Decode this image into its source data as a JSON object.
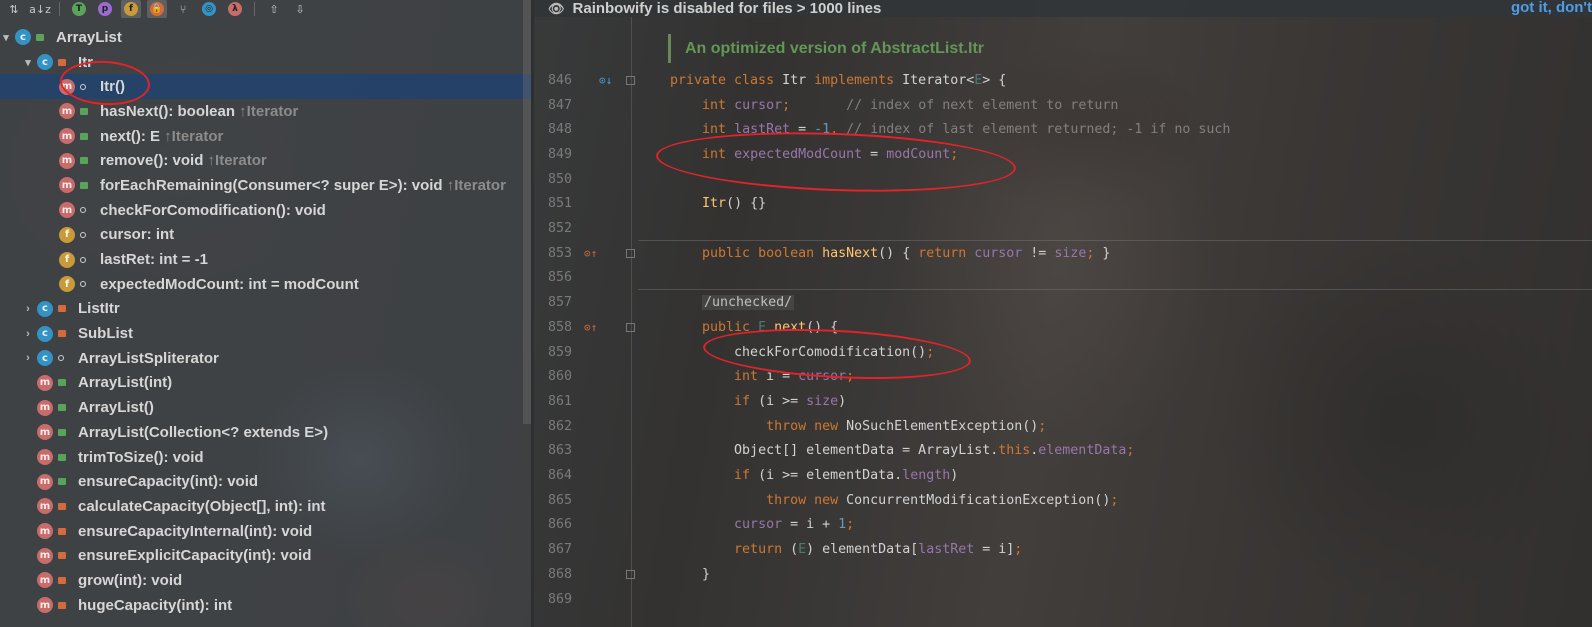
{
  "banner": {
    "message": "Rainbowify is disabled for files > 1000 lines",
    "action": "got it, don't"
  },
  "structure": {
    "toolbar": [
      {
        "icon": "sort-by-visibility-icon",
        "glyph": "⇅"
      },
      {
        "icon": "sort-alphabetically-icon",
        "glyph": "a↓z"
      },
      {
        "icon": "show-inherited-icon",
        "glyph": "T",
        "color": "#5aa35a"
      },
      {
        "icon": "show-properties-icon",
        "glyph": "p",
        "color": "#9b6bd0"
      },
      {
        "icon": "show-fields-icon",
        "glyph": "f",
        "color": "#c89a3a",
        "active": true
      },
      {
        "icon": "show-non-public-icon",
        "glyph": "🔒",
        "color": "#d36b3c",
        "active": true
      },
      {
        "icon": "show-lambdas-icon",
        "glyph": "⑂"
      },
      {
        "icon": "show-anonymous-icon",
        "glyph": "◎",
        "color": "#3592c4"
      },
      {
        "icon": "show-lambda-icon",
        "glyph": "λ",
        "color": "#c76b6b"
      },
      {
        "icon": "autoscroll-to-source-icon",
        "glyph": "⇧"
      },
      {
        "icon": "autoscroll-from-source-icon",
        "glyph": "⇩"
      }
    ],
    "items": [
      {
        "arrow": "▾",
        "indent": 0,
        "kind": "c",
        "vis": "pub",
        "label": "ArrayList",
        "suffix": ""
      },
      {
        "arrow": "▾",
        "indent": 1,
        "kind": "c",
        "vis": "priv",
        "label": "Itr",
        "suffix": ""
      },
      {
        "arrow": "",
        "indent": 2,
        "kind": "m",
        "vis": "pkg",
        "label": "Itr()",
        "suffix": "",
        "selected": true
      },
      {
        "arrow": "",
        "indent": 2,
        "kind": "m",
        "vis": "pub",
        "label": "hasNext(): boolean",
        "suffix": " ↑Iterator"
      },
      {
        "arrow": "",
        "indent": 2,
        "kind": "m",
        "vis": "pub",
        "label": "next(): E",
        "suffix": " ↑Iterator"
      },
      {
        "arrow": "",
        "indent": 2,
        "kind": "m",
        "vis": "pub",
        "label": "remove(): void",
        "suffix": " ↑Iterator"
      },
      {
        "arrow": "",
        "indent": 2,
        "kind": "m",
        "vis": "pub",
        "label": "forEachRemaining(Consumer<? super E>): void",
        "suffix": " ↑Iterator"
      },
      {
        "arrow": "",
        "indent": 2,
        "kind": "m",
        "vis": "pkg",
        "label": "checkForComodification(): void",
        "suffix": ""
      },
      {
        "arrow": "",
        "indent": 2,
        "kind": "f",
        "vis": "pkg",
        "label": "cursor: int",
        "suffix": ""
      },
      {
        "arrow": "",
        "indent": 2,
        "kind": "f",
        "vis": "pkg",
        "label": "lastRet: int = -1",
        "suffix": ""
      },
      {
        "arrow": "",
        "indent": 2,
        "kind": "f",
        "vis": "pkg",
        "label": "expectedModCount: int = modCount",
        "suffix": ""
      },
      {
        "arrow": "›",
        "indent": 1,
        "kind": "c",
        "vis": "priv",
        "label": "ListItr",
        "suffix": ""
      },
      {
        "arrow": "›",
        "indent": 1,
        "kind": "c",
        "vis": "priv",
        "label": "SubList",
        "suffix": ""
      },
      {
        "arrow": "›",
        "indent": 1,
        "kind": "c",
        "vis": "pkg",
        "label": "ArrayListSpliterator",
        "suffix": ""
      },
      {
        "arrow": "",
        "indent": 1,
        "kind": "m",
        "vis": "pub",
        "label": "ArrayList(int)",
        "suffix": ""
      },
      {
        "arrow": "",
        "indent": 1,
        "kind": "m",
        "vis": "pub",
        "label": "ArrayList()",
        "suffix": ""
      },
      {
        "arrow": "",
        "indent": 1,
        "kind": "m",
        "vis": "pub",
        "label": "ArrayList(Collection<? extends E>)",
        "suffix": ""
      },
      {
        "arrow": "",
        "indent": 1,
        "kind": "m",
        "vis": "pub",
        "label": "trimToSize(): void",
        "suffix": ""
      },
      {
        "arrow": "",
        "indent": 1,
        "kind": "m",
        "vis": "pub",
        "label": "ensureCapacity(int): void",
        "suffix": ""
      },
      {
        "arrow": "",
        "indent": 1,
        "kind": "m",
        "vis": "priv",
        "label": "calculateCapacity(Object[], int): int",
        "suffix": ""
      },
      {
        "arrow": "",
        "indent": 1,
        "kind": "m",
        "vis": "priv",
        "label": "ensureCapacityInternal(int): void",
        "suffix": ""
      },
      {
        "arrow": "",
        "indent": 1,
        "kind": "m",
        "vis": "priv",
        "label": "ensureExplicitCapacity(int): void",
        "suffix": ""
      },
      {
        "arrow": "",
        "indent": 1,
        "kind": "m",
        "vis": "priv",
        "label": "grow(int): void",
        "suffix": ""
      },
      {
        "arrow": "",
        "indent": 1,
        "kind": "m",
        "vis": "priv",
        "label": "hugeCapacity(int): int",
        "suffix": ""
      }
    ]
  },
  "editor": {
    "doc_comment": "An optimized version of AbstractList.Itr",
    "lines": [
      {
        "num": "846",
        "gutter": "implements-icon",
        "fold": true,
        "tokens": [
          [
            "kw",
            "private class "
          ],
          [
            "",
            "Itr "
          ],
          [
            "kw",
            "implements "
          ],
          [
            "",
            "Iterator<"
          ],
          [
            "gn",
            "E"
          ],
          [
            "",
            "> {"
          ]
        ]
      },
      {
        "num": "847",
        "tokens": [
          [
            "",
            "    "
          ],
          [
            "kw",
            "int "
          ],
          [
            "fd",
            "cursor"
          ],
          [
            "kw",
            ";       "
          ],
          [
            "cm",
            "// index of next element to return"
          ]
        ]
      },
      {
        "num": "848",
        "tokens": [
          [
            "",
            "    "
          ],
          [
            "kw",
            "int "
          ],
          [
            "fd",
            "lastRet"
          ],
          [
            "",
            " = "
          ],
          [
            "nm",
            "-1"
          ],
          [
            "kw",
            ", "
          ],
          [
            "cm",
            "// index of last element returned; -1 if no such"
          ]
        ]
      },
      {
        "num": "849",
        "tokens": [
          [
            "",
            "    "
          ],
          [
            "kw",
            "int "
          ],
          [
            "fd",
            "expectedModCount"
          ],
          [
            "",
            " = "
          ],
          [
            "fd",
            "modCount"
          ],
          [
            "kw",
            ";"
          ]
        ]
      },
      {
        "num": "850",
        "tokens": []
      },
      {
        "num": "851",
        "tokens": [
          [
            "",
            "    "
          ],
          [
            "fn",
            "Itr"
          ],
          [
            "",
            "() {}"
          ]
        ]
      },
      {
        "num": "852",
        "tokens": [],
        "separator_after": true
      },
      {
        "num": "853",
        "gutter": "implementing-icon",
        "fold": true,
        "tokens": [
          [
            "",
            "    "
          ],
          [
            "kw",
            "public boolean "
          ],
          [
            "fn",
            "hasNext"
          ],
          [
            "",
            "() { "
          ],
          [
            "kw",
            "return "
          ],
          [
            "fd",
            "cursor"
          ],
          [
            "",
            " != "
          ],
          [
            "fd",
            "size"
          ],
          [
            "kw",
            "; "
          ],
          [
            "",
            "}"
          ]
        ]
      },
      {
        "num": "856",
        "tokens": [],
        "separator_after": true
      },
      {
        "num": "857",
        "tokens": [
          [
            "",
            "    "
          ],
          [
            "tag",
            "/unchecked/"
          ]
        ]
      },
      {
        "num": "858",
        "gutter": "implementing-icon",
        "fold": true,
        "tokens": [
          [
            "",
            "    "
          ],
          [
            "kw",
            "public "
          ],
          [
            "gn",
            "E "
          ],
          [
            "fn",
            "next"
          ],
          [
            "",
            "() {"
          ]
        ]
      },
      {
        "num": "859",
        "tokens": [
          [
            "",
            "        "
          ],
          [
            "",
            "checkForComodification()"
          ],
          [
            "kw",
            ";"
          ]
        ]
      },
      {
        "num": "860",
        "tokens": [
          [
            "",
            "        "
          ],
          [
            "kw",
            "int "
          ],
          [
            "",
            "i = "
          ],
          [
            "fd",
            "cursor"
          ],
          [
            "kw",
            ";"
          ]
        ]
      },
      {
        "num": "861",
        "tokens": [
          [
            "",
            "        "
          ],
          [
            "kw",
            "if "
          ],
          [
            "",
            "(i >= "
          ],
          [
            "fd",
            "size"
          ],
          [
            "",
            ")"
          ]
        ]
      },
      {
        "num": "862",
        "tokens": [
          [
            "",
            "            "
          ],
          [
            "kw",
            "throw new "
          ],
          [
            "",
            "NoSuchElementException()"
          ],
          [
            "kw",
            ";"
          ]
        ]
      },
      {
        "num": "863",
        "tokens": [
          [
            "",
            "        "
          ],
          [
            "",
            "Object[] elementData = ArrayList."
          ],
          [
            "kw",
            "this"
          ],
          [
            "",
            "."
          ],
          [
            "fd",
            "elementData"
          ],
          [
            "kw",
            ";"
          ]
        ]
      },
      {
        "num": "864",
        "tokens": [
          [
            "",
            "        "
          ],
          [
            "kw",
            "if "
          ],
          [
            "",
            "(i >= elementData."
          ],
          [
            "fd",
            "length"
          ],
          [
            "",
            ")"
          ]
        ]
      },
      {
        "num": "865",
        "tokens": [
          [
            "",
            "            "
          ],
          [
            "kw",
            "throw new "
          ],
          [
            "",
            "ConcurrentModificationException()"
          ],
          [
            "kw",
            ";"
          ]
        ]
      },
      {
        "num": "866",
        "tokens": [
          [
            "",
            "        "
          ],
          [
            "fd",
            "cursor"
          ],
          [
            "",
            " = i + "
          ],
          [
            "nm",
            "1"
          ],
          [
            "kw",
            ";"
          ]
        ]
      },
      {
        "num": "867",
        "tokens": [
          [
            "",
            "        "
          ],
          [
            "kw",
            "return "
          ],
          [
            "",
            "("
          ],
          [
            "gn",
            "E"
          ],
          [
            "",
            ") elementData["
          ],
          [
            "fd",
            "lastRet"
          ],
          [
            "",
            " = i]"
          ],
          [
            "kw",
            ";"
          ]
        ]
      },
      {
        "num": "868",
        "fold": true,
        "tokens": [
          [
            "",
            "    "
          ],
          [
            "",
            "}"
          ]
        ]
      },
      {
        "num": "869",
        "tokens": []
      }
    ]
  },
  "colors": {
    "annotation": "#e0242a",
    "selection": "#21426e",
    "link": "#4f9de6",
    "doc_comment": "#629755"
  }
}
